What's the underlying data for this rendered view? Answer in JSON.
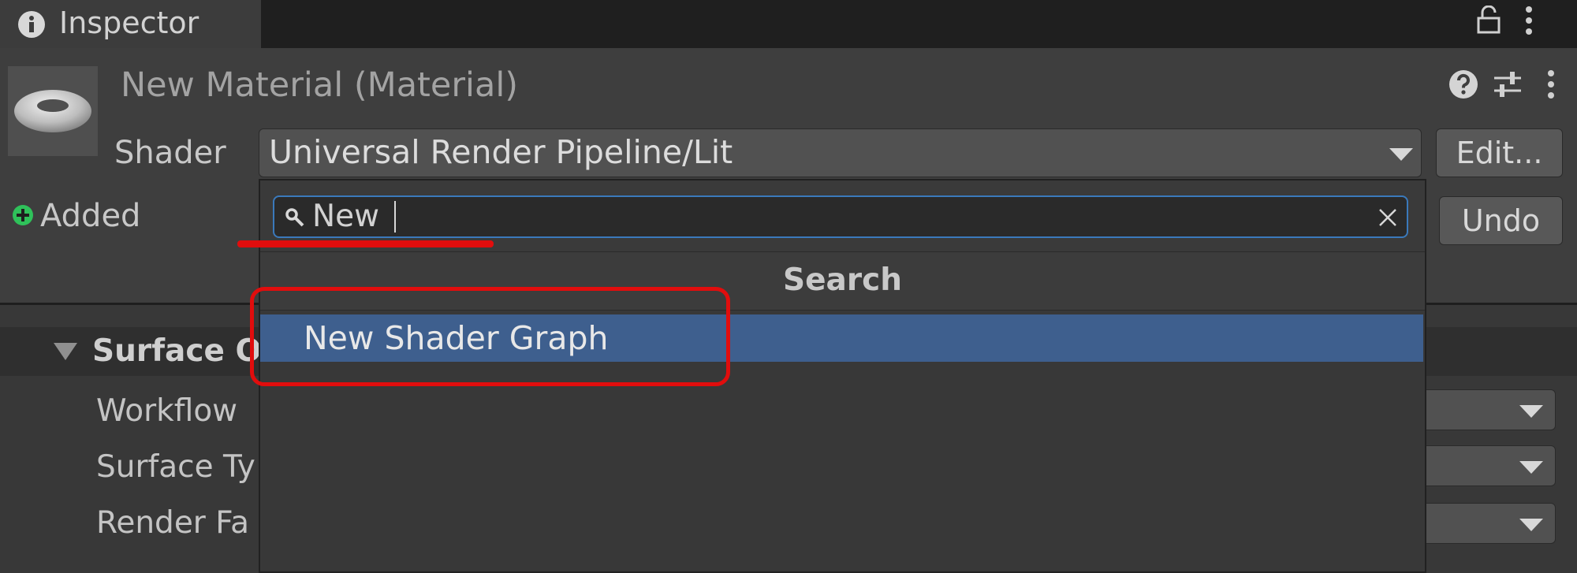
{
  "window": {
    "tab_title": "Inspector"
  },
  "material": {
    "title": "New Material (Material)",
    "shader_label": "Shader",
    "shader_value": "Universal Render Pipeline/Lit",
    "edit_label": "Edit...",
    "added_label": "Added",
    "undo_label": "Undo"
  },
  "surface_options": {
    "title": "Surface O",
    "properties": [
      {
        "label": "Workflow"
      },
      {
        "label": "Surface Ty"
      },
      {
        "label": "Render Fa"
      }
    ]
  },
  "popup": {
    "search_value": "New",
    "heading": "Search",
    "results": [
      "New Shader Graph"
    ]
  },
  "icons": {
    "tab": "info-icon",
    "lock": "lock-icon",
    "menu": "kebab-menu-icon",
    "help": "help-icon",
    "presets": "presets-sliders-icon",
    "added": "plus-circle-icon",
    "search": "search-icon",
    "clear": "close-icon",
    "dropdown": "triangle-down-icon"
  },
  "colors": {
    "background": "#383838",
    "selection": "#3e5f8e",
    "focus_border": "#3a79bb",
    "added_green": "#2fc15a",
    "annotation_red": "#e10d0d"
  }
}
